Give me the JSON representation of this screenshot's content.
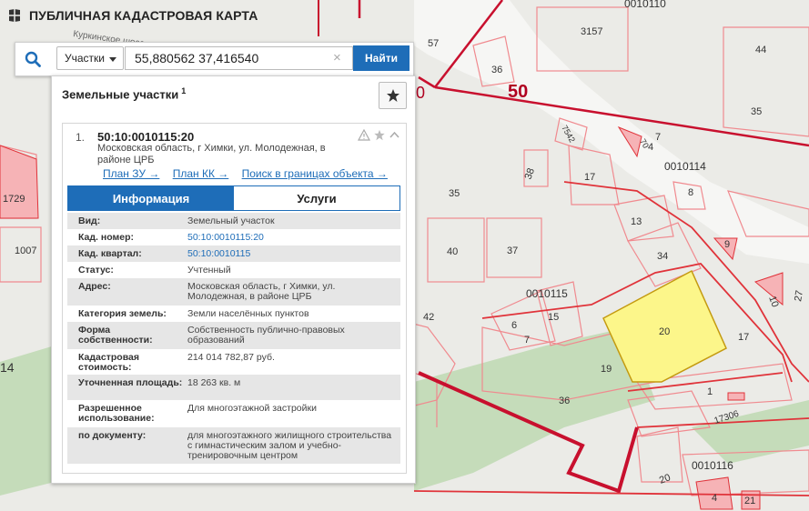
{
  "app": {
    "title": "ПУБЛИЧНАЯ КАДАСТРОВАЯ КАРТА"
  },
  "search": {
    "type_selected": "Участки",
    "value": "55,880562 37,416540",
    "clear_symbol": "×",
    "submit_label": "Найти"
  },
  "panel": {
    "title": "Земельные участки",
    "count": "1"
  },
  "result": {
    "index": "1.",
    "cad_number": "50:10:0010115:20",
    "address": "Московская область, г Химки, ул. Молодежная, в районе ЦРБ",
    "links": [
      "План ЗУ →",
      "План КК →",
      "Поиск в границах объекта →"
    ],
    "tabs": [
      "Информация",
      "Услуги"
    ],
    "active_tab": "Информация",
    "info": [
      {
        "key": "Вид:",
        "value": "Земельный участок"
      },
      {
        "key": "Кад. номер:",
        "value": "50:10:0010115:20"
      },
      {
        "key": "Кад. квартал:",
        "value": "50:10:0010115"
      },
      {
        "key": "Статус:",
        "value": "Учтенный"
      },
      {
        "key": "Адрес:",
        "value": "Московская область, г Химки, ул. Молодежная, в районе ЦРБ"
      },
      {
        "key": "Категория земель:",
        "value": "Земли населённых пунктов"
      },
      {
        "key": "Форма собственности:",
        "value": "Собственность публично-правовых образований"
      },
      {
        "key": "Кадастровая стоимость:",
        "value": "214 014 782,87 руб."
      },
      {
        "key": "Уточненная площадь:",
        "value": "18 263 кв. м"
      },
      {
        "key": "Разрешенное использование:",
        "value": "Для многоэтажной застройки"
      },
      {
        "key": "по документу:",
        "value": "для многоэтажного жилищного строительства с гимнастическим залом и учебно-тренировочным центром"
      }
    ]
  },
  "map": {
    "street": "Куркинское шоссе",
    "labels": {
      "q110": "0010110",
      "q114": "0010114",
      "q115": "0010115",
      "q116": "0010116",
      "p3157": "3157",
      "p44": "44",
      "p35a": "35",
      "p36": "36",
      "p57": "57",
      "p7542": "7542",
      "p70": "70",
      "p7": "7",
      "p4": "4",
      "p17a": "17",
      "p38": "38",
      "p35": "35",
      "p8": "8",
      "p13": "13",
      "p34": "34",
      "p40": "40",
      "p37": "37",
      "p9": "9",
      "p10": "10",
      "p27": "27",
      "p1729": "1729",
      "p1007": "1007",
      "p42": "42",
      "p14": "14",
      "p6": "6",
      "p15": "15",
      "p7b": "7",
      "p20": "20",
      "p17b": "17",
      "p19": "19",
      "p1": "1",
      "p36b": "36",
      "p17306": "17306",
      "p20b": "20",
      "p4b": "4",
      "p21": "21",
      "big50": "50",
      "edge0": "0"
    },
    "colors": {
      "boundary": "#e0333a",
      "district": "#c8102e",
      "selected_fill": "#fcf68a",
      "forest": "#c4dcb8",
      "accent": "#1e6db8"
    }
  },
  "icons": [
    "map-logo-icon",
    "search-icon",
    "caret-down-icon",
    "clear-icon",
    "star-icon",
    "warning-icon",
    "star-outline-icon",
    "chevron-up-icon"
  ]
}
